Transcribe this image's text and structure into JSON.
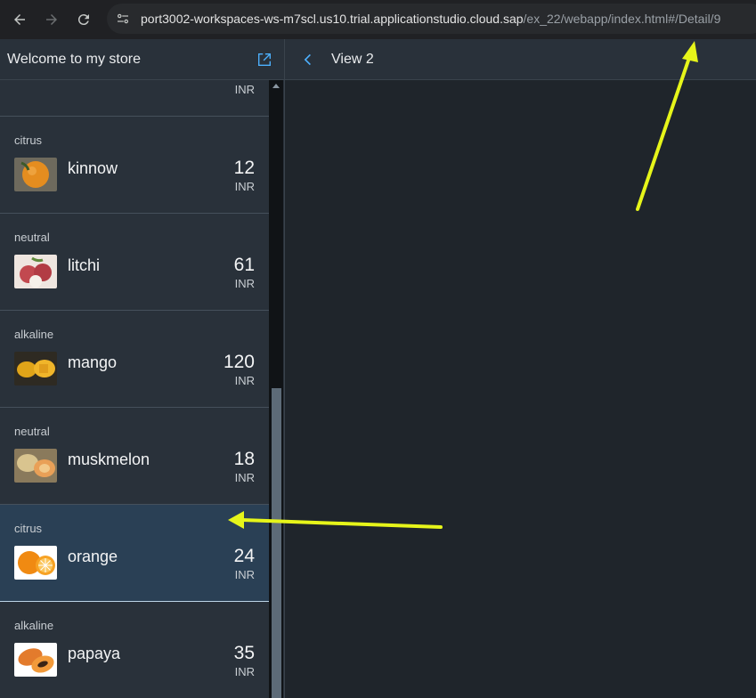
{
  "browser": {
    "url_host": "port3002-workspaces-ws-m7scl.us10.trial.applicationstudio.cloud.sap",
    "url_path": "/ex_22/webapp/index.html#/Detail/9",
    "back_icon": "arrow-left-icon",
    "forward_icon": "arrow-right-icon",
    "reload_icon": "reload-icon"
  },
  "master": {
    "title": "Welcome to my store",
    "share_icon": "share-icon",
    "items": [
      {
        "category": "",
        "name": "",
        "price": "",
        "unit": "INR",
        "thumb": "partial"
      },
      {
        "category": "citrus",
        "name": "kinnow",
        "price": "12",
        "unit": "INR",
        "thumb": "kinnow"
      },
      {
        "category": "neutral",
        "name": "litchi",
        "price": "61",
        "unit": "INR",
        "thumb": "litchi"
      },
      {
        "category": "alkaline",
        "name": "mango",
        "price": "120",
        "unit": "INR",
        "thumb": "mango"
      },
      {
        "category": "neutral",
        "name": "muskmelon",
        "price": "18",
        "unit": "INR",
        "thumb": "muskmelon"
      },
      {
        "category": "citrus",
        "name": "orange",
        "price": "24",
        "unit": "INR",
        "thumb": "orange",
        "selected": true
      },
      {
        "category": "alkaline",
        "name": "papaya",
        "price": "35",
        "unit": "INR",
        "thumb": "papaya"
      }
    ]
  },
  "detail": {
    "title": "View 2",
    "back_icon": "chevron-left-icon"
  },
  "colors": {
    "accent": "#4db1ff",
    "annotation_arrow": "#e6f51a",
    "selected_row": "#2a4055"
  }
}
